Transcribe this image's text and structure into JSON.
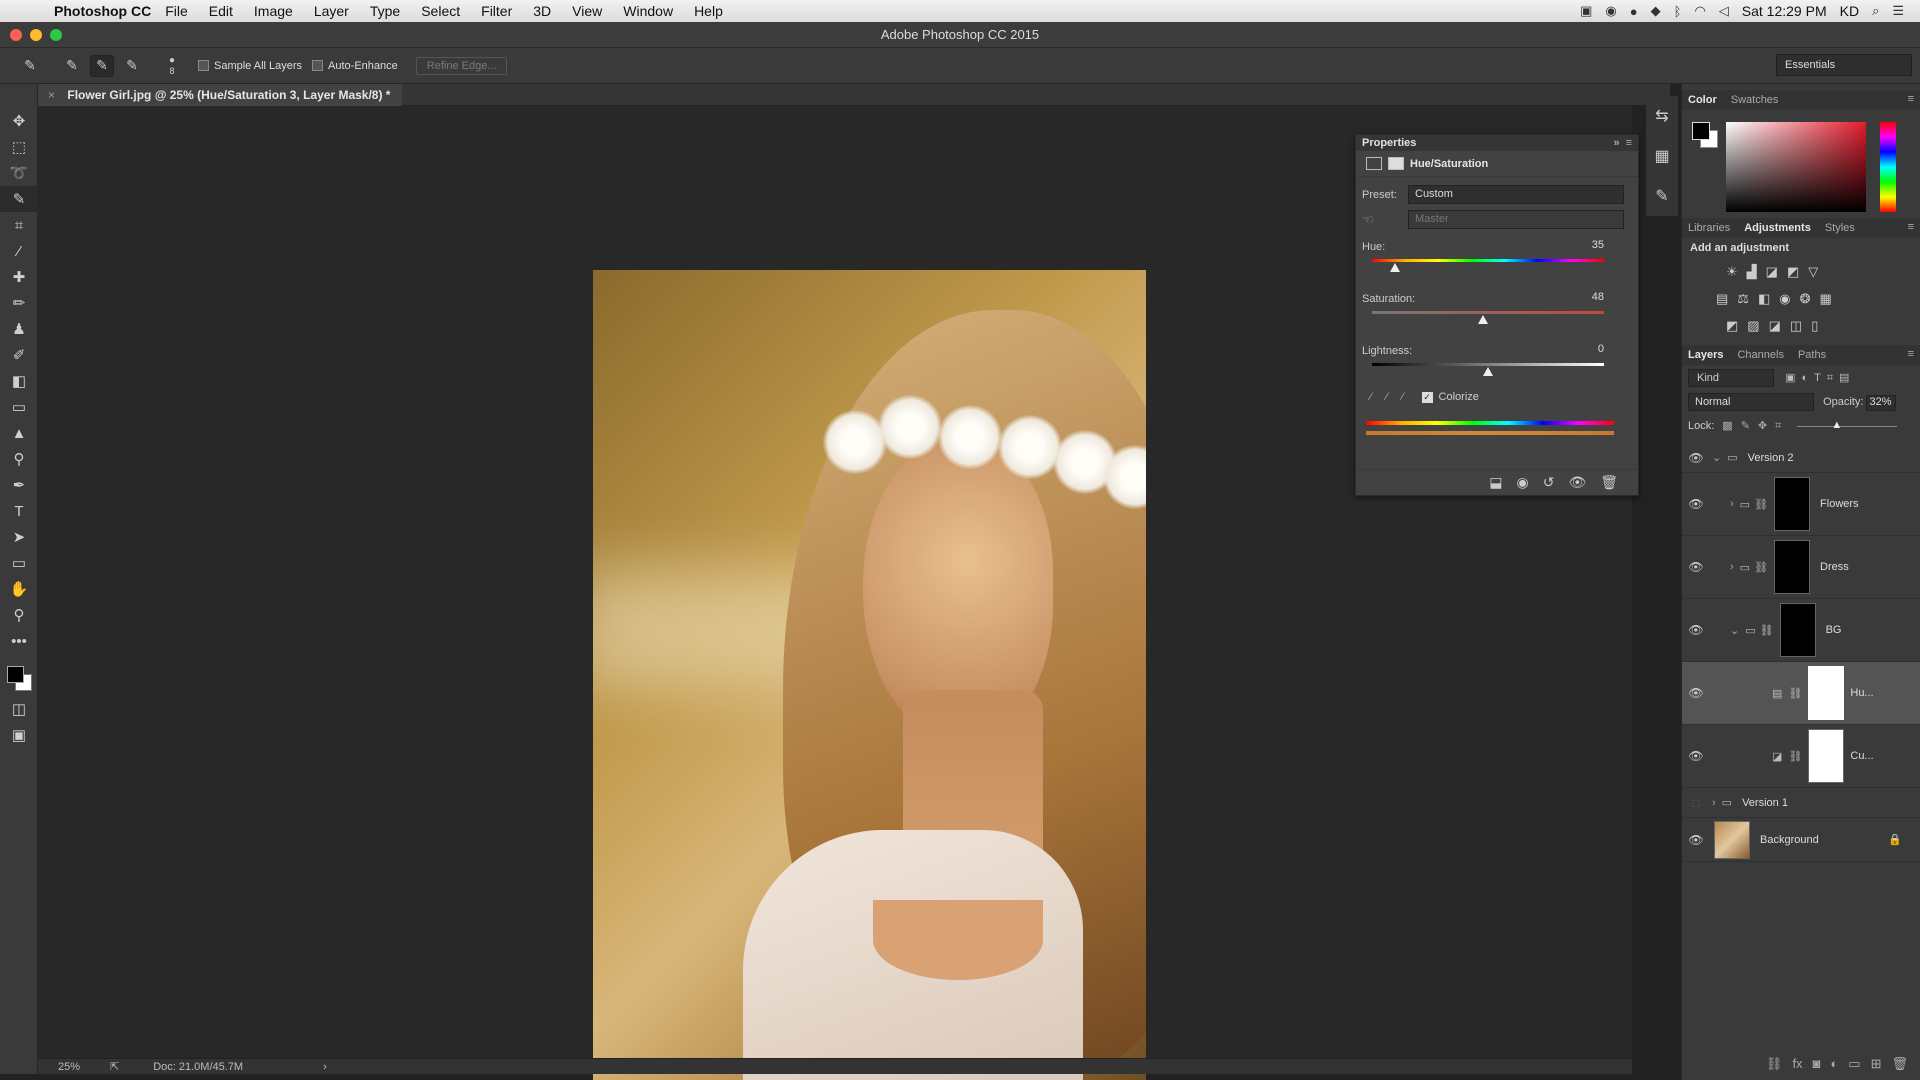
{
  "menubar": {
    "apple_icon": "apple-icon",
    "app_name": "Photoshop CC",
    "menus": [
      "File",
      "Edit",
      "Image",
      "Layer",
      "Type",
      "Select",
      "Filter",
      "3D",
      "View",
      "Window",
      "Help"
    ],
    "clock": "Sat 12:29 PM",
    "user": "KD"
  },
  "window": {
    "title": "Adobe Photoshop CC 2015"
  },
  "options": {
    "brush_size": "8",
    "sample_all_layers": "Sample All Layers",
    "auto_enhance": "Auto-Enhance",
    "refine_edge": "Refine Edge...",
    "workspace": "Essentials"
  },
  "document": {
    "tab_title": "Flower Girl.jpg @ 25% (Hue/Saturation 3, Layer Mask/8) *",
    "zoom": "25%",
    "doc_size": "Doc: 21.0M/45.7M"
  },
  "properties": {
    "panel_title": "Properties",
    "adjustment_name": "Hue/Saturation",
    "preset_label": "Preset:",
    "preset_value": "Custom",
    "channel_value": "Master",
    "hue_label": "Hue:",
    "hue_value": "35",
    "hue_level": 0.1,
    "saturation_label": "Saturation:",
    "saturation_value": "48",
    "saturation_level": 0.48,
    "lightness_label": "Lightness:",
    "lightness_value": "0",
    "lightness_level": 0.5,
    "colorize_label": "Colorize",
    "colorize_checked": true
  },
  "color_panel": {
    "tabs": [
      "Color",
      "Swatches"
    ]
  },
  "adjustments_panel": {
    "tabs": [
      "Libraries",
      "Adjustments",
      "Styles"
    ],
    "add_label": "Add an adjustment"
  },
  "layers_panel": {
    "tabs": [
      "Layers",
      "Channels",
      "Paths"
    ],
    "kind_label": "Kind",
    "blend_mode": "Normal",
    "opacity_label": "Opacity:",
    "opacity_value": "32%",
    "lock_label": "Lock:",
    "layers": [
      {
        "name": "Version 2",
        "type": "group"
      },
      {
        "name": "Flowers",
        "type": "group"
      },
      {
        "name": "Dress",
        "type": "group"
      },
      {
        "name": "BG",
        "type": "group"
      },
      {
        "name": "Hu...",
        "type": "adjustment"
      },
      {
        "name": "Cu...",
        "type": "adjustment"
      },
      {
        "name": "Version 1",
        "type": "group"
      },
      {
        "name": "Background",
        "type": "image"
      }
    ]
  }
}
